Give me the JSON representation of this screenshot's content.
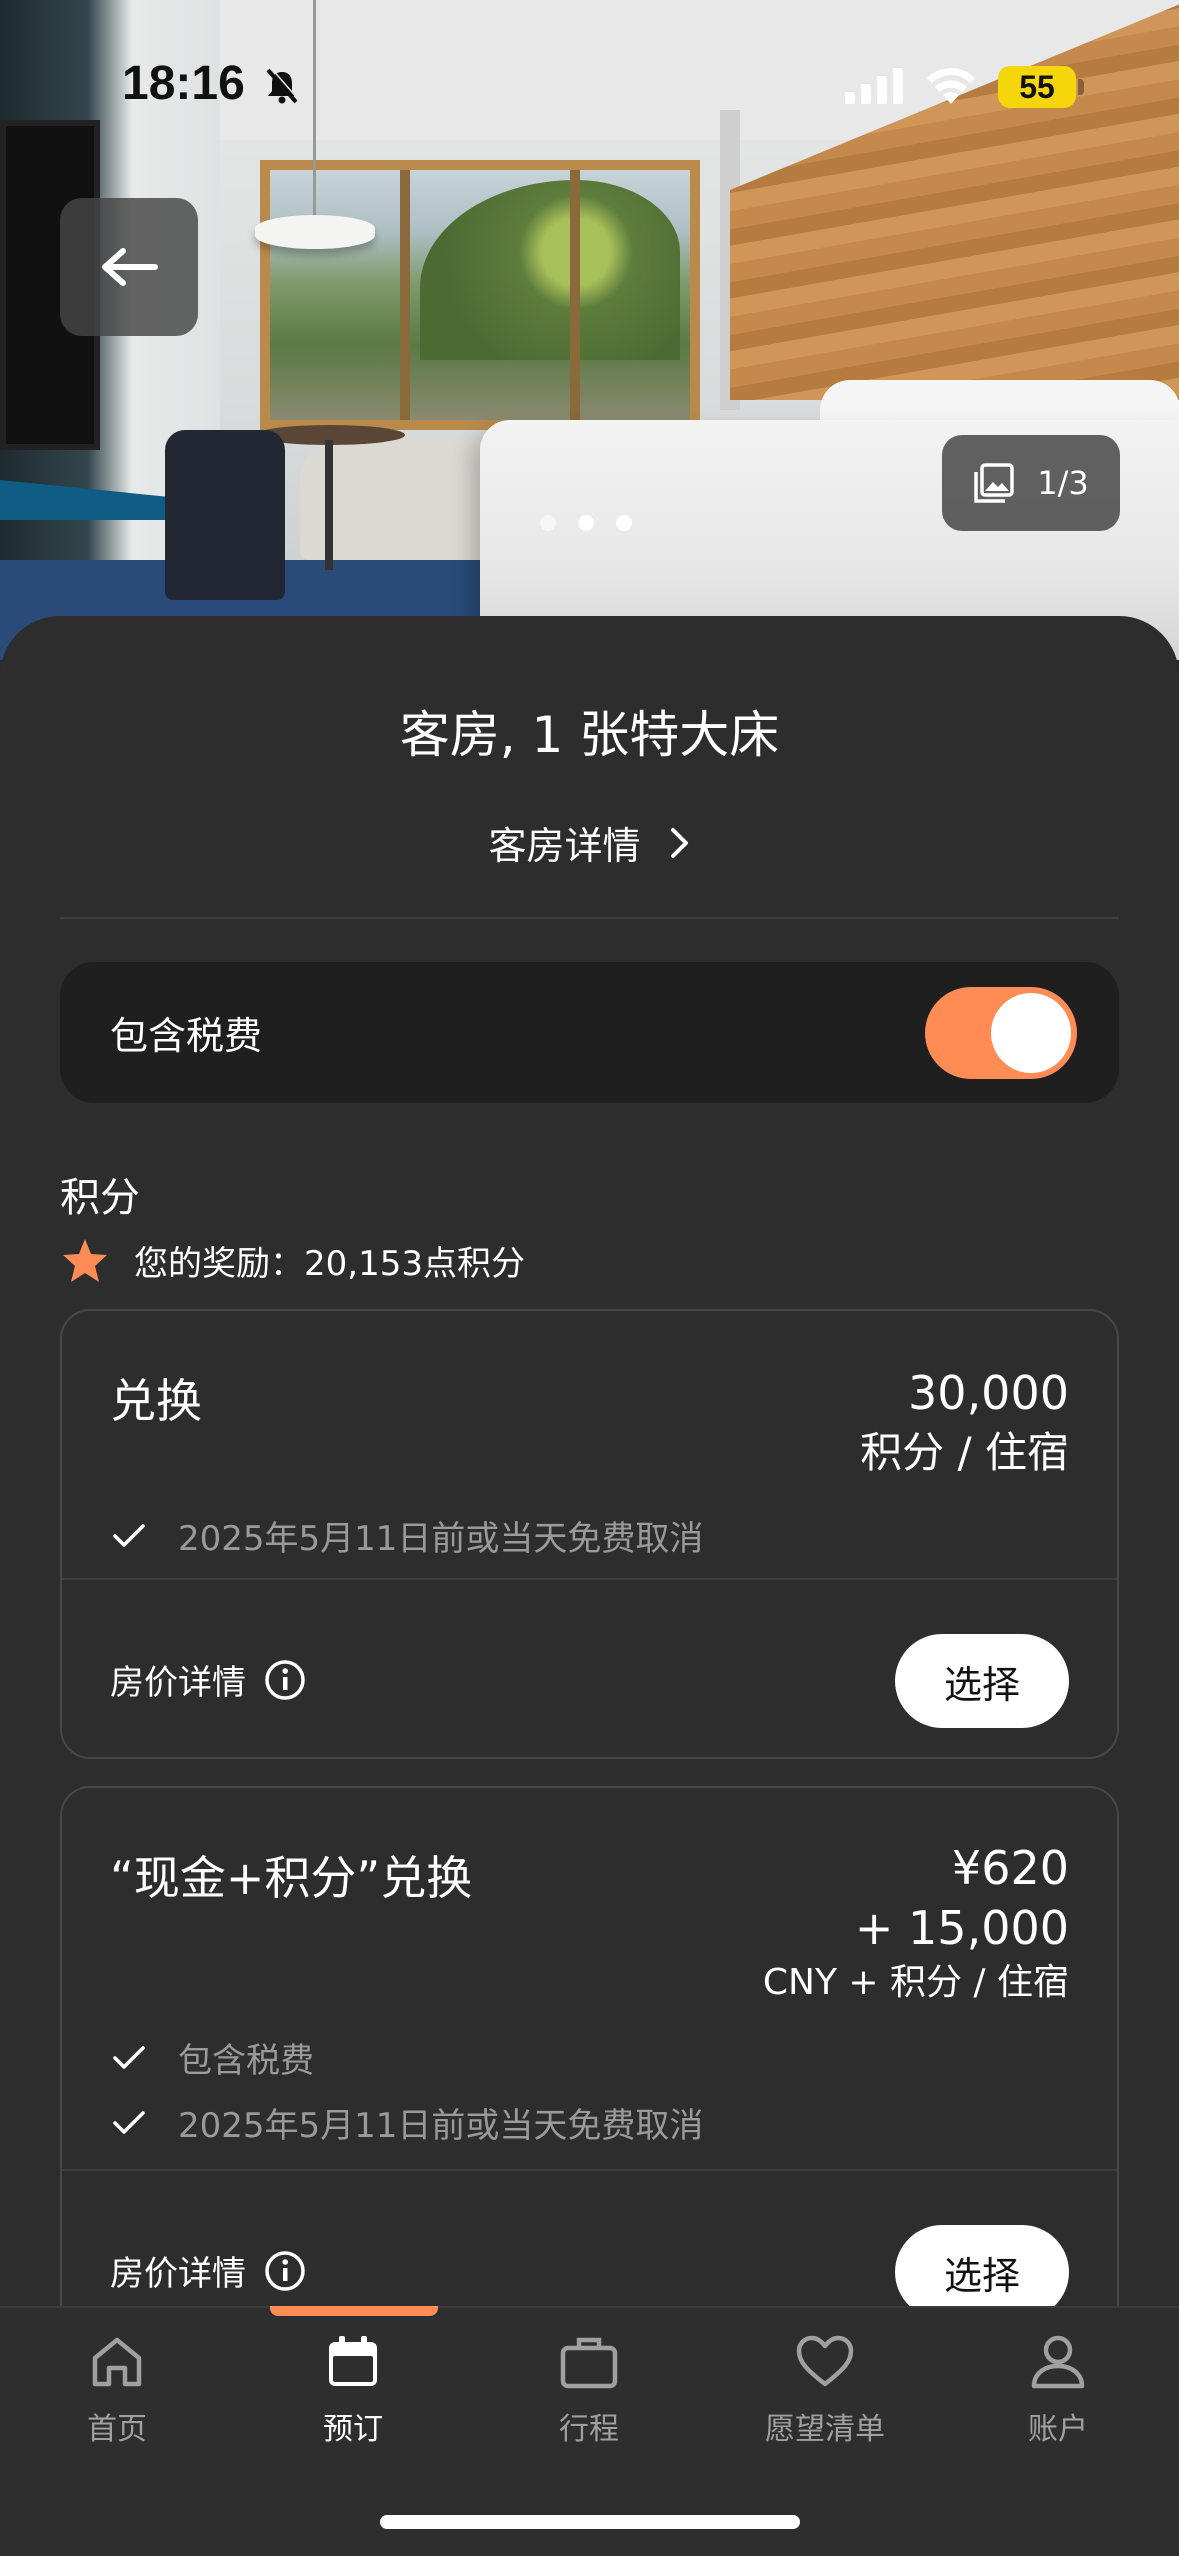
{
  "status_bar": {
    "time": "18:16",
    "battery": "55"
  },
  "hero": {
    "photo_counter": "1/3",
    "dots": 3,
    "active_dot": 2
  },
  "room": {
    "title": "客房, 1 张特大床",
    "details_link": "客房详情"
  },
  "tax_toggle": {
    "label": "包含税费",
    "on": true
  },
  "points": {
    "heading": "积分",
    "reward_text": "您的奖励：20,153点积分"
  },
  "rates": [
    {
      "name": "兑换",
      "price_line1": "30,000",
      "price_line2": "积分 / 住宿",
      "benefits": [
        "2025年5月11日前或当天免费取消"
      ],
      "details_label": "房价详情",
      "select_label": "选择"
    },
    {
      "name": "“现金+积分”兑换",
      "price_line1": "¥620",
      "price_line2": "+ 15,000",
      "price_line3": "CNY + 积分 / 住宿",
      "benefits": [
        "包含税费",
        "2025年5月11日前或当天免费取消"
      ],
      "details_label": "房价详情",
      "select_label": "选择"
    }
  ],
  "tabs": [
    {
      "label": "首页",
      "icon": "home-icon",
      "active": false
    },
    {
      "label": "预订",
      "icon": "calendar-icon",
      "active": true
    },
    {
      "label": "行程",
      "icon": "briefcase-icon",
      "active": false
    },
    {
      "label": "愿望清单",
      "icon": "heart-icon",
      "active": false
    },
    {
      "label": "账户",
      "icon": "person-icon",
      "active": false
    }
  ],
  "colors": {
    "accent": "#ff8c55",
    "background": "#2d2d2d",
    "battery": "#f5d50b"
  }
}
